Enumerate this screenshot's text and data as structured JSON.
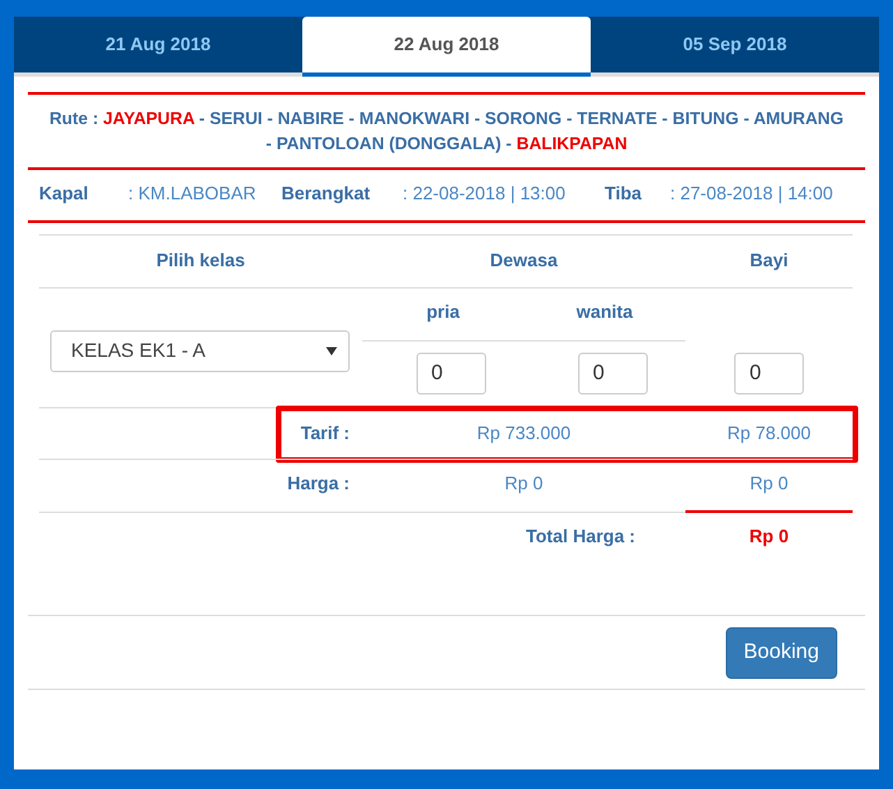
{
  "tabs": [
    {
      "label": "21 Aug 2018",
      "selected": false
    },
    {
      "label": "22 Aug 2018",
      "selected": true
    },
    {
      "label": "05 Sep 2018",
      "selected": false
    }
  ],
  "route": {
    "label": "Rute :",
    "separator": "-",
    "stops": [
      {
        "name": "JAYAPURA",
        "highlight": true
      },
      {
        "name": "SERUI",
        "highlight": false
      },
      {
        "name": "NABIRE",
        "highlight": false
      },
      {
        "name": "MANOKWARI",
        "highlight": false
      },
      {
        "name": "SORONG",
        "highlight": false
      },
      {
        "name": "TERNATE",
        "highlight": false
      },
      {
        "name": "BITUNG",
        "highlight": false
      },
      {
        "name": "AMURANG",
        "highlight": false
      },
      {
        "name": "PANTOLOAN (DONGGALA)",
        "highlight": false
      },
      {
        "name": "BALIKPAPAN",
        "highlight": true
      }
    ]
  },
  "trip": [
    {
      "label": "Kapal",
      "value": ": KM.LABOBAR"
    },
    {
      "label": "Berangkat",
      "value": ": 22-08-2018 | 13:00"
    },
    {
      "label": "Tiba",
      "value": ": 27-08-2018 | 14:00"
    }
  ],
  "form": {
    "headers": {
      "class": "Pilih kelas",
      "adult": "Dewasa",
      "infant": "Bayi"
    },
    "subheaders": [
      "pria",
      "wanita"
    ],
    "class_select": {
      "value": "KELAS EK1 - A"
    },
    "counts": {
      "male": "0",
      "female": "0",
      "infant": "0"
    },
    "tarif": {
      "label": "Tarif :",
      "adult": "Rp 733.000",
      "infant": "Rp 78.000",
      "highlighted": true
    },
    "harga": {
      "label": "Harga :",
      "adult": "Rp 0",
      "infant": "Rp 0"
    },
    "total": {
      "label": "Total Harga :",
      "value": "Rp 0"
    }
  },
  "booking_button": "Booking"
}
